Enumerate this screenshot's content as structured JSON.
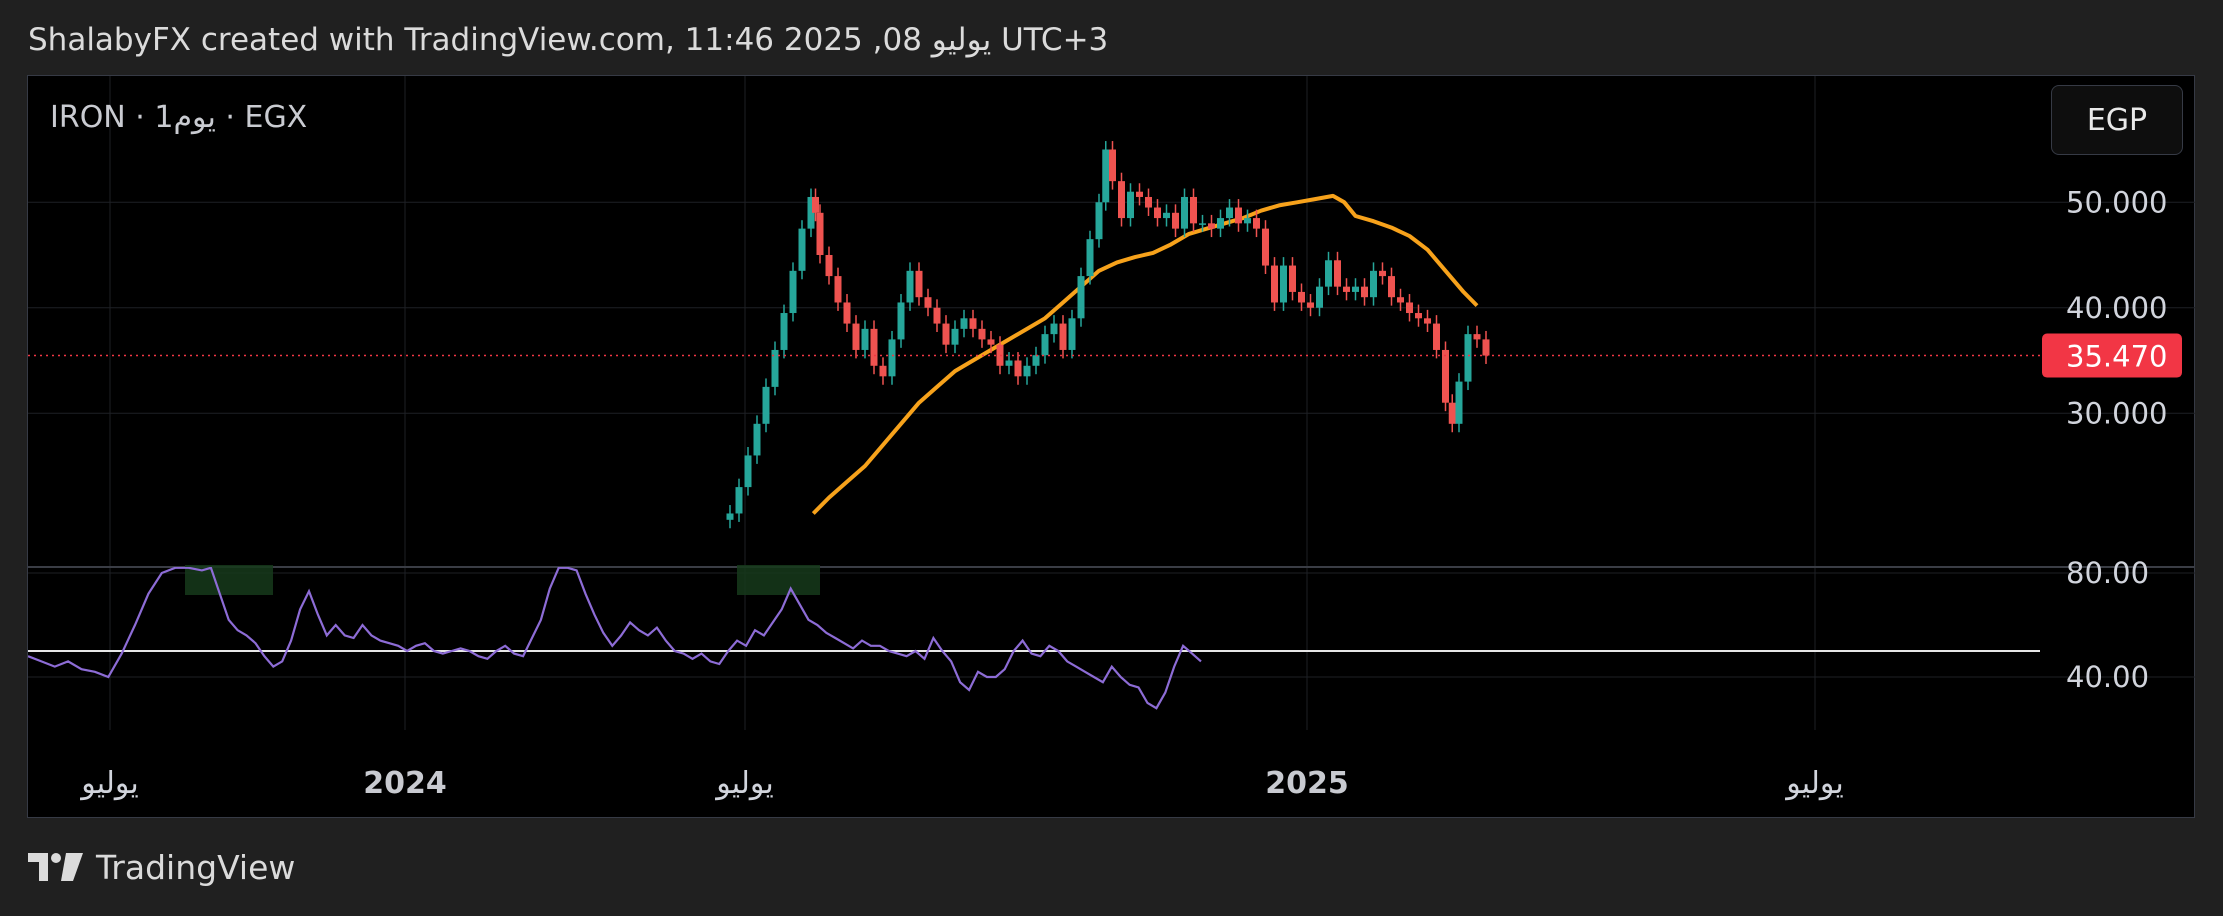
{
  "header": {
    "attribution": "ShalabyFX created with TradingView.com, يوليو 08, 2025 11:46 UTC+3"
  },
  "symbol": {
    "label": "IRON · 1يوم · EGX"
  },
  "currency": {
    "label": "EGP"
  },
  "footer": {
    "brand": "TradingView"
  },
  "colors": {
    "background": "#000000",
    "page": "#202020",
    "up": "#26a69a",
    "down": "#ef5350",
    "sma": "#f7a21b",
    "rsi": "#8d6cd6",
    "price_tag": "#f23645"
  },
  "chart_data": {
    "type": "candlestick",
    "price_panel": {
      "y_ticks": [
        "50.000",
        "40.000",
        "30.000"
      ],
      "y_tick_values": [
        50,
        40,
        30
      ],
      "last_price": 35.47,
      "last_price_label": "35.470",
      "candles_close": [
        [
          0,
          20.5
        ],
        [
          0.4,
          23
        ],
        [
          0.8,
          26
        ],
        [
          1.2,
          29
        ],
        [
          1.6,
          32.5
        ],
        [
          2.0,
          36
        ],
        [
          2.4,
          39.5
        ],
        [
          2.8,
          43.5
        ],
        [
          3.2,
          47.5
        ],
        [
          3.6,
          50.5
        ],
        [
          3.8,
          49
        ],
        [
          4.0,
          45
        ],
        [
          4.4,
          43
        ],
        [
          4.8,
          40.5
        ],
        [
          5.2,
          38.5
        ],
        [
          5.6,
          36
        ],
        [
          6.0,
          38
        ],
        [
          6.4,
          34.5
        ],
        [
          6.8,
          33.5
        ],
        [
          7.2,
          37
        ],
        [
          7.6,
          40.5
        ],
        [
          8.0,
          43.5
        ],
        [
          8.4,
          41
        ],
        [
          8.8,
          40
        ],
        [
          9.2,
          38.5
        ],
        [
          9.6,
          36.5
        ],
        [
          10.0,
          38
        ],
        [
          10.4,
          39
        ],
        [
          10.8,
          38
        ],
        [
          11.2,
          37
        ],
        [
          11.6,
          36.5
        ],
        [
          12.0,
          34.5
        ],
        [
          12.4,
          35
        ],
        [
          12.8,
          33.5
        ],
        [
          13.2,
          34.5
        ],
        [
          13.6,
          35.5
        ],
        [
          14.0,
          37.5
        ],
        [
          14.4,
          38.5
        ],
        [
          14.8,
          36
        ],
        [
          15.2,
          39
        ],
        [
          15.6,
          43
        ],
        [
          16.0,
          46.5
        ],
        [
          16.4,
          50
        ],
        [
          16.7,
          55
        ],
        [
          17.0,
          52
        ],
        [
          17.4,
          48.5
        ],
        [
          17.8,
          51
        ],
        [
          18.2,
          50.5
        ],
        [
          18.6,
          49.5
        ],
        [
          19.0,
          48.5
        ],
        [
          19.4,
          49
        ],
        [
          19.8,
          47.5
        ],
        [
          20.2,
          50.5
        ],
        [
          20.6,
          48
        ],
        [
          21.0,
          48
        ],
        [
          21.4,
          47.5
        ],
        [
          21.8,
          48.5
        ],
        [
          22.2,
          49.5
        ],
        [
          22.6,
          48
        ],
        [
          23.0,
          48.5
        ],
        [
          23.4,
          47.5
        ],
        [
          23.8,
          44
        ],
        [
          24.2,
          40.5
        ],
        [
          24.6,
          44
        ],
        [
          25.0,
          41.5
        ],
        [
          25.4,
          40.5
        ],
        [
          25.8,
          40
        ],
        [
          26.2,
          42
        ],
        [
          26.6,
          44.5
        ],
        [
          27.0,
          42
        ],
        [
          27.4,
          41.5
        ],
        [
          27.8,
          42
        ],
        [
          28.2,
          41
        ],
        [
          28.6,
          43.5
        ],
        [
          29.0,
          43
        ],
        [
          29.4,
          41
        ],
        [
          29.8,
          40.5
        ],
        [
          30.2,
          39.5
        ],
        [
          30.6,
          39
        ],
        [
          31.0,
          38.5
        ],
        [
          31.4,
          36
        ],
        [
          31.8,
          31
        ],
        [
          32.1,
          29
        ],
        [
          32.4,
          33
        ],
        [
          32.8,
          37.5
        ],
        [
          33.2,
          37
        ],
        [
          33.6,
          35.47
        ]
      ]
    },
    "sma": [
      [
        3.7,
        20.5
      ],
      [
        4.4,
        22
      ],
      [
        5.2,
        23.5
      ],
      [
        6.0,
        25
      ],
      [
        6.8,
        27
      ],
      [
        7.6,
        29
      ],
      [
        8.4,
        31
      ],
      [
        9.2,
        32.5
      ],
      [
        10.0,
        34
      ],
      [
        10.8,
        35
      ],
      [
        11.6,
        36
      ],
      [
        12.4,
        37
      ],
      [
        13.2,
        38
      ],
      [
        14.0,
        39
      ],
      [
        14.8,
        40.5
      ],
      [
        15.6,
        42
      ],
      [
        16.4,
        43.5
      ],
      [
        17.2,
        44.3
      ],
      [
        18.0,
        44.8
      ],
      [
        18.8,
        45.2
      ],
      [
        19.6,
        46
      ],
      [
        20.4,
        47
      ],
      [
        21.2,
        47.5
      ],
      [
        22.0,
        48
      ],
      [
        22.8,
        48.5
      ],
      [
        23.6,
        49.2
      ],
      [
        24.4,
        49.7
      ],
      [
        25.2,
        50
      ],
      [
        26.0,
        50.3
      ],
      [
        26.8,
        50.6
      ],
      [
        27.3,
        50
      ],
      [
        27.8,
        48.7
      ],
      [
        28.6,
        48.2
      ],
      [
        29.4,
        47.6
      ],
      [
        30.2,
        46.8
      ],
      [
        31.0,
        45.5
      ],
      [
        31.8,
        43.5
      ],
      [
        32.6,
        41.5
      ],
      [
        33.2,
        40.2
      ]
    ],
    "rsi_panel": {
      "y_ticks": [
        "80.00",
        "40.00"
      ],
      "y_tick_values": [
        80,
        40
      ],
      "level_line": 50,
      "values": [
        [
          -12.0,
          48
        ],
        [
          -11.4,
          46
        ],
        [
          -10.8,
          44
        ],
        [
          -10.2,
          46
        ],
        [
          -9.6,
          43
        ],
        [
          -9.0,
          42
        ],
        [
          -8.4,
          40
        ],
        [
          -7.8,
          49
        ],
        [
          -7.2,
          60
        ],
        [
          -6.6,
          72
        ],
        [
          -6.0,
          80
        ],
        [
          -5.4,
          82
        ],
        [
          -4.8,
          82
        ],
        [
          -4.2,
          81
        ],
        [
          -3.8,
          82
        ],
        [
          -3.4,
          72
        ],
        [
          -3.0,
          62
        ],
        [
          -2.6,
          58
        ],
        [
          -2.2,
          56
        ],
        [
          -1.8,
          53
        ],
        [
          -1.4,
          48
        ],
        [
          -1.0,
          44
        ],
        [
          -0.6,
          46
        ],
        [
          -0.2,
          54
        ],
        [
          0.2,
          66
        ],
        [
          0.6,
          73
        ],
        [
          1.0,
          64
        ],
        [
          1.4,
          56
        ],
        [
          1.8,
          60
        ],
        [
          2.2,
          56
        ],
        [
          2.6,
          55
        ],
        [
          3.0,
          60
        ],
        [
          3.4,
          56
        ],
        [
          3.8,
          54
        ],
        [
          4.2,
          53
        ],
        [
          4.6,
          52
        ],
        [
          5.0,
          50
        ],
        [
          5.4,
          52
        ],
        [
          5.8,
          53
        ],
        [
          6.2,
          50
        ],
        [
          6.6,
          49
        ],
        [
          7.0,
          50
        ],
        [
          7.4,
          51
        ],
        [
          7.8,
          50
        ],
        [
          8.2,
          48
        ],
        [
          8.6,
          47
        ],
        [
          9.0,
          50
        ],
        [
          9.4,
          52
        ],
        [
          9.8,
          49
        ],
        [
          10.2,
          48
        ],
        [
          10.6,
          55
        ],
        [
          11.0,
          62
        ],
        [
          11.4,
          74
        ],
        [
          11.8,
          82
        ],
        [
          12.2,
          82
        ],
        [
          12.6,
          81
        ],
        [
          13.0,
          72
        ],
        [
          13.4,
          64
        ],
        [
          13.8,
          57
        ],
        [
          14.2,
          52
        ],
        [
          14.6,
          56
        ],
        [
          15.0,
          61
        ],
        [
          15.4,
          58
        ],
        [
          15.8,
          56
        ],
        [
          16.2,
          59
        ],
        [
          16.6,
          54
        ],
        [
          17.0,
          50
        ],
        [
          17.4,
          49
        ],
        [
          17.8,
          47
        ],
        [
          18.2,
          49
        ],
        [
          18.6,
          46
        ],
        [
          19.0,
          45
        ],
        [
          19.4,
          50
        ],
        [
          19.8,
          54
        ],
        [
          20.2,
          52
        ],
        [
          20.6,
          58
        ],
        [
          21.0,
          56
        ],
        [
          21.4,
          61
        ],
        [
          21.8,
          66
        ],
        [
          22.2,
          74
        ],
        [
          22.6,
          68
        ],
        [
          23.0,
          62
        ],
        [
          23.4,
          60
        ],
        [
          23.8,
          57
        ],
        [
          24.2,
          55
        ],
        [
          24.6,
          53
        ],
        [
          25.0,
          51
        ],
        [
          25.4,
          54
        ],
        [
          25.8,
          52
        ],
        [
          26.2,
          52
        ],
        [
          26.6,
          50
        ],
        [
          27.0,
          49
        ],
        [
          27.4,
          48
        ],
        [
          27.8,
          50
        ],
        [
          28.2,
          47
        ],
        [
          28.6,
          55
        ],
        [
          29.0,
          50
        ],
        [
          29.4,
          46
        ],
        [
          29.8,
          38
        ],
        [
          30.2,
          35
        ],
        [
          30.6,
          42
        ],
        [
          31.0,
          40
        ],
        [
          31.4,
          40
        ],
        [
          31.8,
          43
        ],
        [
          32.2,
          50
        ],
        [
          32.6,
          54
        ],
        [
          33.0,
          49
        ],
        [
          33.4,
          48
        ],
        [
          33.8,
          52
        ],
        [
          34.2,
          50
        ],
        [
          34.6,
          46
        ],
        [
          35.0,
          44
        ],
        [
          35.4,
          42
        ],
        [
          35.8,
          40
        ],
        [
          36.2,
          38
        ],
        [
          36.6,
          44
        ],
        [
          37.0,
          40
        ],
        [
          37.4,
          37
        ],
        [
          37.8,
          36
        ],
        [
          38.2,
          30
        ],
        [
          38.6,
          28
        ],
        [
          39.0,
          34
        ],
        [
          39.4,
          44
        ],
        [
          39.8,
          52
        ],
        [
          40.2,
          49
        ],
        [
          40.6,
          46
        ]
      ]
    },
    "x_axis": {
      "labels": [
        {
          "text": "يوليو",
          "bold": false
        },
        {
          "text": "2024",
          "bold": true
        },
        {
          "text": "يوليو",
          "bold": false
        },
        {
          "text": "2025",
          "bold": true
        },
        {
          "text": "يوليو",
          "bold": false
        }
      ]
    },
    "grid": true
  }
}
